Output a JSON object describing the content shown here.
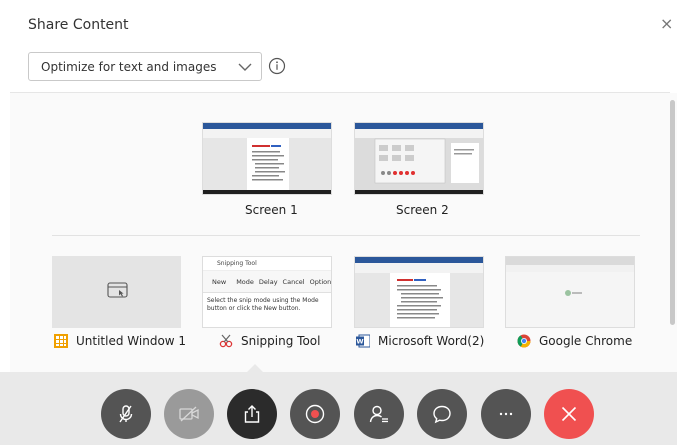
{
  "dialog": {
    "title": "Share Content",
    "close_glyph": "×"
  },
  "optimize": {
    "selected": "Optimize for text and images",
    "icons": [
      "chevron-down-icon",
      "info-icon"
    ]
  },
  "screens": [
    {
      "label": "Screen 1"
    },
    {
      "label": "Screen 2"
    }
  ],
  "apps": [
    {
      "label": "Untitled Window 1",
      "icon": "window-app-icon"
    },
    {
      "label": "Snipping Tool",
      "icon": "snipping-tool-icon",
      "thumb_text": {
        "title": "Snipping Tool",
        "new": "New",
        "mode": "Mode",
        "delay": "Delay",
        "cancel": "Cancel",
        "options": "Options",
        "body": "Select the snip mode using the Mode button or click the New button."
      }
    },
    {
      "label": "Microsoft Word(2)",
      "icon": "word-icon"
    },
    {
      "label": "Google Chrome",
      "icon": "chrome-icon"
    }
  ],
  "toolbar": {
    "buttons": [
      {
        "name": "mute-microphone-button",
        "icon": "microphone-muted-icon"
      },
      {
        "name": "video-off-button",
        "icon": "video-off-icon"
      },
      {
        "name": "share-button",
        "icon": "share-icon"
      },
      {
        "name": "record-button",
        "icon": "record-icon"
      },
      {
        "name": "participants-button",
        "icon": "participants-icon"
      },
      {
        "name": "chat-button",
        "icon": "chat-icon"
      },
      {
        "name": "more-options-button",
        "icon": "more-icon"
      },
      {
        "name": "leave-meeting-button",
        "icon": "close-icon"
      }
    ],
    "colors": {
      "dark": "#545454",
      "active": "#2b2b2b",
      "disabled": "#9a9a9a",
      "end": "#f05050"
    }
  }
}
